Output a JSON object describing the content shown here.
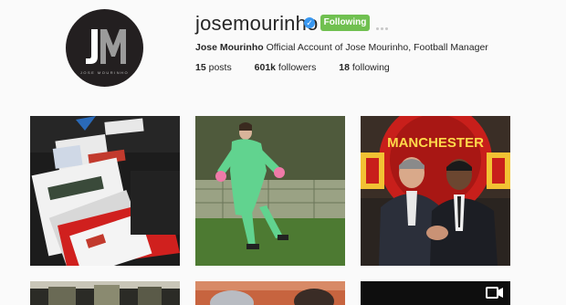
{
  "profile": {
    "username": "josemourinho",
    "verified_icon": "checkmark-icon",
    "follow_label": "Following",
    "bio_name": "Jose Mourinho",
    "bio_text": "Official Account of Jose Mourinho, Football Manager",
    "avatar_monogram": "JM",
    "avatar_caption": "JOSE MOURINHO",
    "stats": {
      "posts_count": "15",
      "posts_label": "posts",
      "followers_count": "601k",
      "followers_label": "followers",
      "following_count": "18",
      "following_label": "following"
    }
  },
  "photos": [
    {
      "description_icon": "document-folder-photo"
    },
    {
      "description_icon": "goalkeeper-photo"
    },
    {
      "description_icon": "manchester-crest-photo",
      "crest_text": "MANCHESTER"
    },
    {
      "description_icon": "stadium-photo"
    },
    {
      "description_icon": "crowd-photo"
    },
    {
      "description_icon": "video-photo",
      "video_icon": "video-camera-icon"
    }
  ],
  "colors": {
    "follow_green": "#70c050",
    "verified_blue": "#3897f0",
    "background": "#fafafa"
  }
}
